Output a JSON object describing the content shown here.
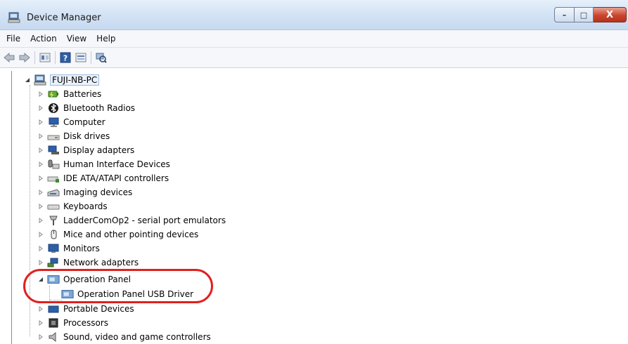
{
  "window": {
    "title": "Device Manager",
    "caption_buttons": {
      "minimize": "–",
      "maximize": "□",
      "close": "X"
    }
  },
  "menu": [
    "File",
    "Action",
    "View",
    "Help"
  ],
  "toolbar": [
    "back-arrow-icon",
    "forward-arrow-icon",
    "properties-icon",
    "help-icon",
    "details-icon",
    "scan-hardware-icon"
  ],
  "tree": {
    "root": {
      "label": "FUJI-NB-PC",
      "icon": "computer-icon",
      "expanded": true
    },
    "categories": [
      {
        "label": "Batteries",
        "icon": "battery-icon"
      },
      {
        "label": "Bluetooth Radios",
        "icon": "bluetooth-icon"
      },
      {
        "label": "Computer",
        "icon": "monitor-icon"
      },
      {
        "label": "Disk drives",
        "icon": "disk-drive-icon"
      },
      {
        "label": "Display adapters",
        "icon": "display-adapter-icon"
      },
      {
        "label": "Human Interface Devices",
        "icon": "hid-icon"
      },
      {
        "label": "IDE ATA/ATAPI controllers",
        "icon": "ide-controller-icon"
      },
      {
        "label": "Imaging devices",
        "icon": "imaging-icon"
      },
      {
        "label": "Keyboards",
        "icon": "keyboard-icon"
      },
      {
        "label": "LadderComOp2 - serial port emulators",
        "icon": "serial-port-icon"
      },
      {
        "label": "Mice and other pointing devices",
        "icon": "mouse-icon"
      },
      {
        "label": "Monitors",
        "icon": "monitor-icon"
      },
      {
        "label": "Network adapters",
        "icon": "network-adapter-icon"
      },
      {
        "label": "Operation Panel",
        "icon": "operation-panel-icon",
        "expanded": true,
        "children": [
          {
            "label": "Operation Panel USB Driver",
            "icon": "operation-panel-icon"
          }
        ]
      },
      {
        "label": "Portable Devices",
        "icon": "portable-device-icon"
      },
      {
        "label": "Processors",
        "icon": "processor-icon"
      },
      {
        "label": "Sound, video and game controllers",
        "icon": "speaker-icon"
      }
    ]
  },
  "colors": {
    "highlight_ring": "#e02020",
    "title_bar": "#d5e4f5"
  }
}
